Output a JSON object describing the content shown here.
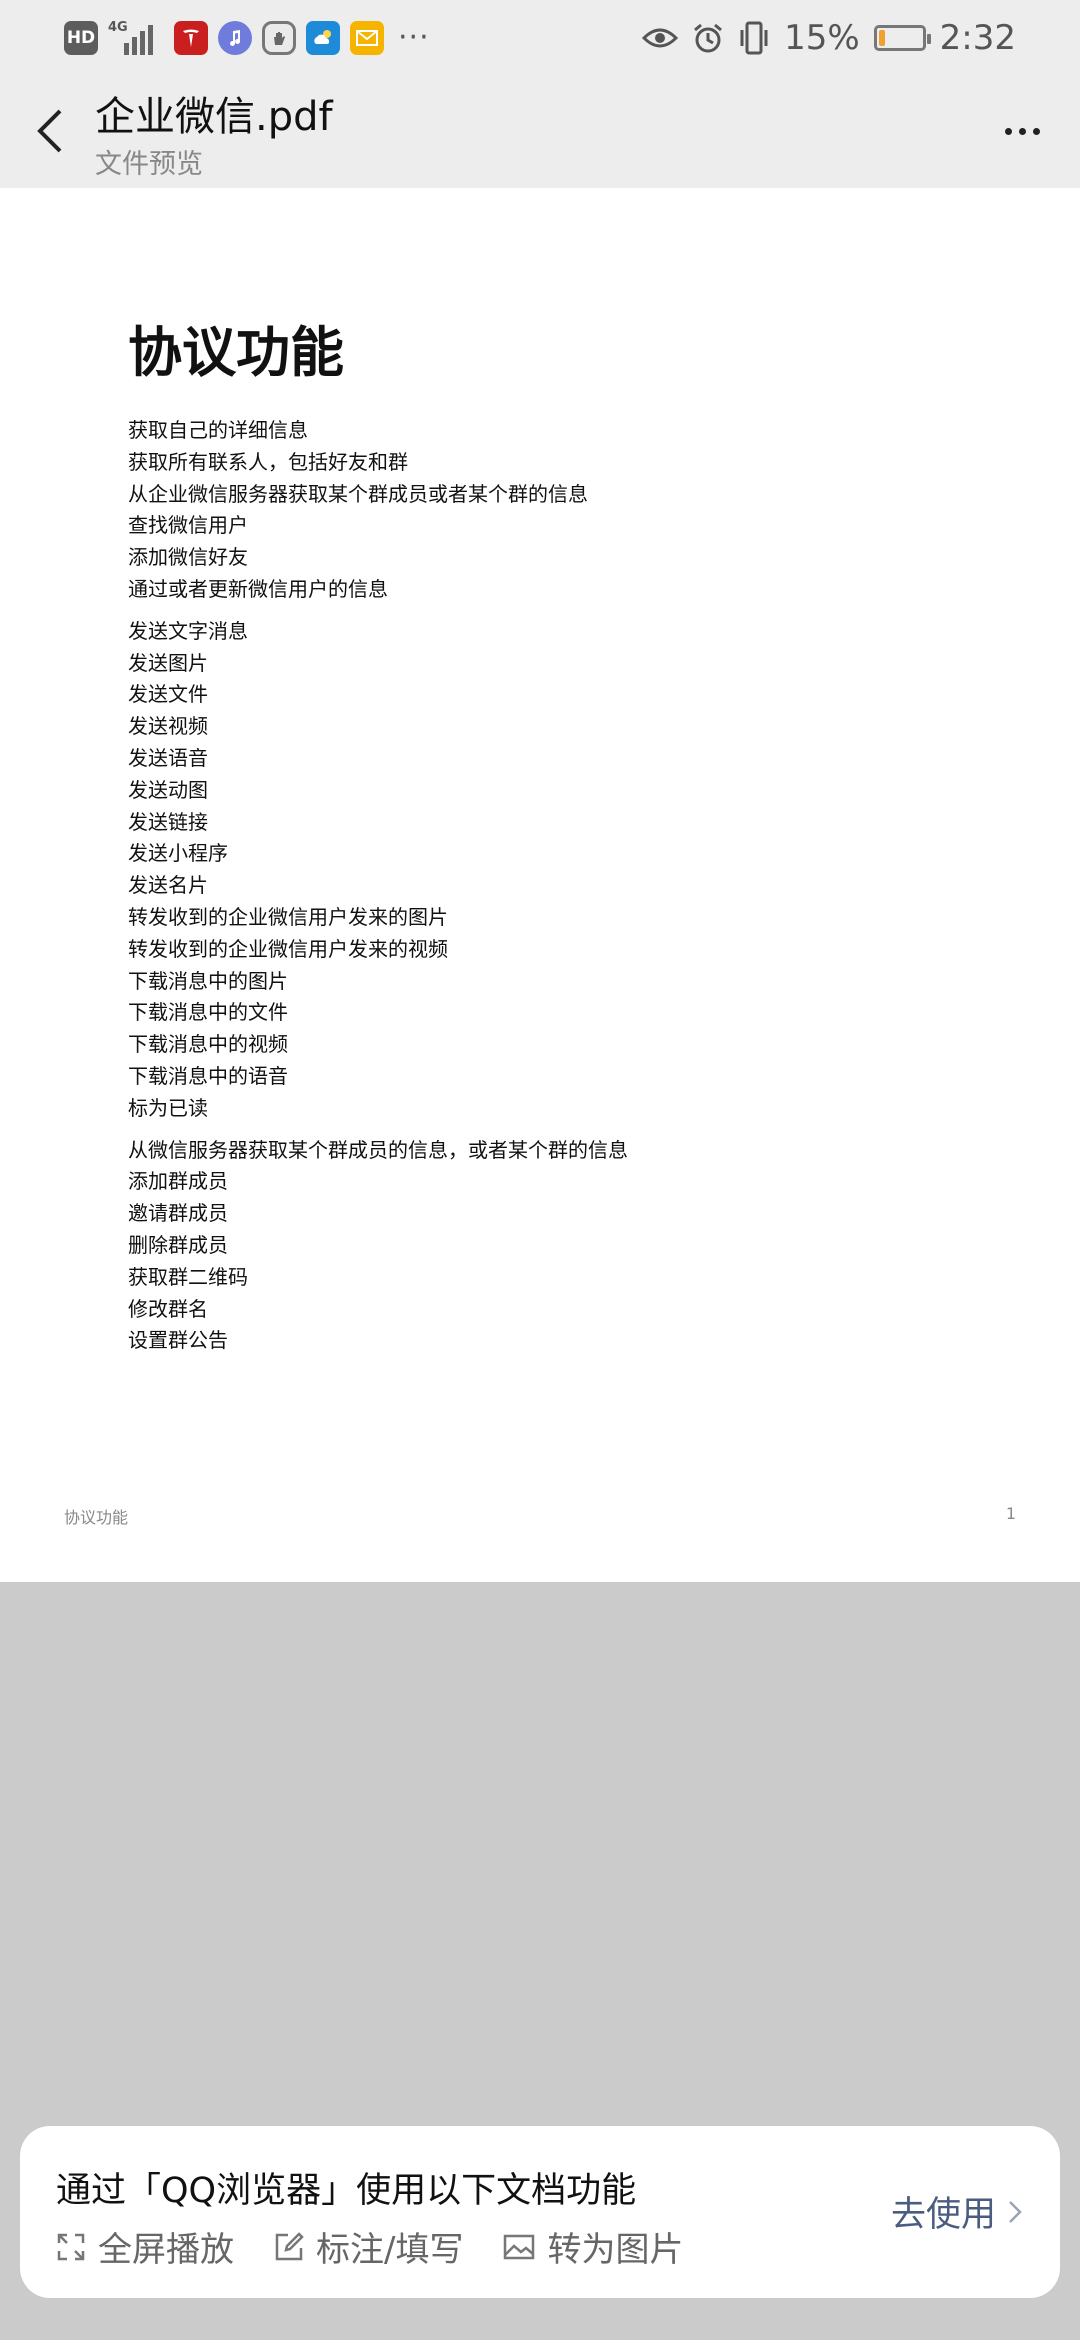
{
  "status_bar": {
    "hd_label": "HD",
    "network_label": "4G",
    "battery_text": "15%",
    "battery_level": 0.15,
    "time": "2:32",
    "overflow_dots": "···"
  },
  "header": {
    "title": "企业微信.pdf",
    "subtitle": "文件预览"
  },
  "document": {
    "heading": "协议功能",
    "groups": [
      {
        "lines": [
          "获取自己的详细信息",
          "获取所有联系人，包括好友和群",
          "从企业微信服务器获取某个群成员或者某个群的信息",
          "查找微信用户",
          "添加微信好友",
          "通过或者更新微信用户的信息"
        ]
      },
      {
        "lines": [
          "发送文字消息",
          "发送图片",
          "发送文件",
          "发送视频",
          "发送语音",
          "发送动图",
          "发送链接",
          "发送小程序",
          "发送名片",
          "转发收到的企业微信用户发来的图片",
          "转发收到的企业微信用户发来的视频",
          "下载消息中的图片",
          "下载消息中的文件",
          "下载消息中的视频",
          "下载消息中的语音",
          "标为已读"
        ]
      },
      {
        "lines": [
          "从微信服务器获取某个群成员的信息，或者某个群的信息",
          "添加群成员",
          "邀请群成员",
          "删除群成员",
          "获取群二维码",
          "修改群名",
          "设置群公告"
        ]
      }
    ],
    "footer_left": "协议功能",
    "footer_page": "1"
  },
  "promo": {
    "title": "通过「QQ浏览器」使用以下文档功能",
    "actions": [
      {
        "label": "全屏播放",
        "icon": "fullscreen-icon"
      },
      {
        "label": "标注/填写",
        "icon": "edit-icon"
      },
      {
        "label": "转为图片",
        "icon": "image-icon"
      }
    ],
    "go_label": "去使用"
  },
  "colors": {
    "bar_bg": "#ededed",
    "viewer_bg": "#cbcbcb",
    "link_blue": "#4a5d80",
    "battery_orange": "#f0a030"
  }
}
